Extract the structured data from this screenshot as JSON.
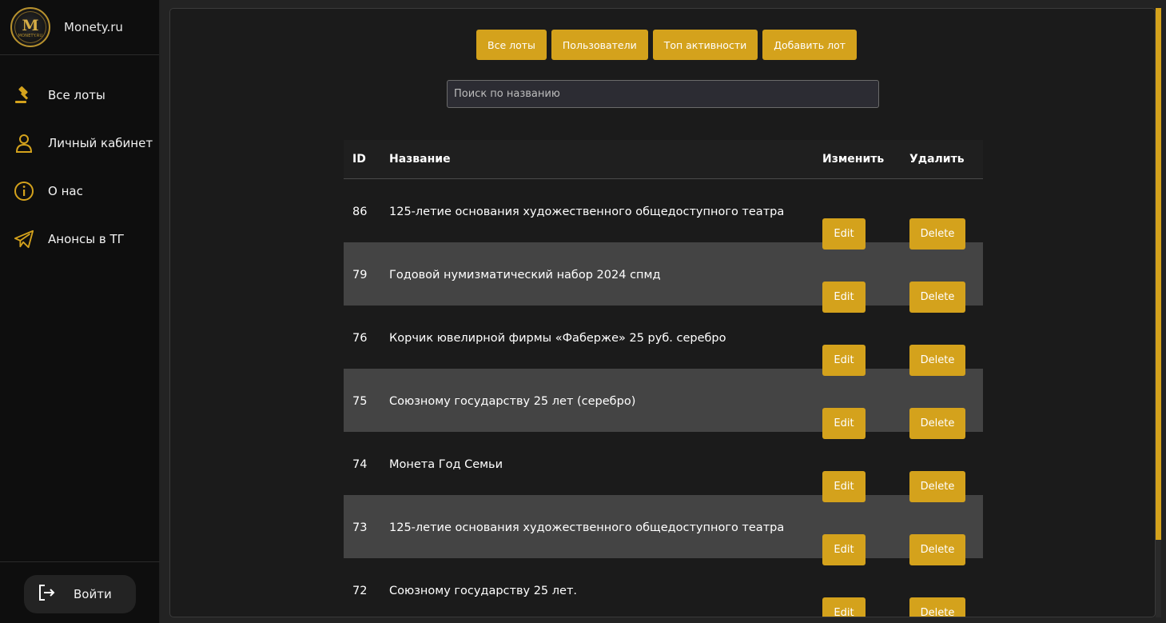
{
  "brand": {
    "name": "Monety.ru",
    "logo_letter": "M",
    "logo_caption": "MONETY.RU"
  },
  "sidebar": {
    "items": [
      {
        "label": "Все лоты",
        "icon": "gavel-icon"
      },
      {
        "label": "Личный кабинет",
        "icon": "user-icon"
      },
      {
        "label": "О нас",
        "icon": "info-icon"
      },
      {
        "label": "Анонсы в ТГ",
        "icon": "telegram-icon"
      }
    ],
    "login_label": "Войти"
  },
  "toolbar": {
    "buttons": [
      "Все лоты",
      "Пользователи",
      "Топ активности",
      "Добавить лот"
    ]
  },
  "search": {
    "placeholder": "Поиск по названию",
    "value": ""
  },
  "table": {
    "headers": {
      "id": "ID",
      "name": "Название",
      "edit": "Изменить",
      "delete": "Удалить"
    },
    "edit_label": "Edit",
    "delete_label": "Delete",
    "rows": [
      {
        "id": "86",
        "name": "125-летие основания художественного общедоступного театра"
      },
      {
        "id": "79",
        "name": "Годовой нумизматический набор 2024 спмд"
      },
      {
        "id": "76",
        "name": "Корчик ювелирной фирмы «Фаберже» 25 руб. серебро"
      },
      {
        "id": "75",
        "name": "Союзному государству 25 лет (серебро)"
      },
      {
        "id": "74",
        "name": "Монета Год Семьи"
      },
      {
        "id": "73",
        "name": "125-летие основания художественного общедоступного театра"
      },
      {
        "id": "72",
        "name": "Союзному государству 25 лет."
      }
    ]
  },
  "colors": {
    "accent": "#d4a21c",
    "sidebar_bg": "#0e0e0e",
    "content_bg": "#1b1b1b",
    "row_alt_bg": "#444444"
  }
}
